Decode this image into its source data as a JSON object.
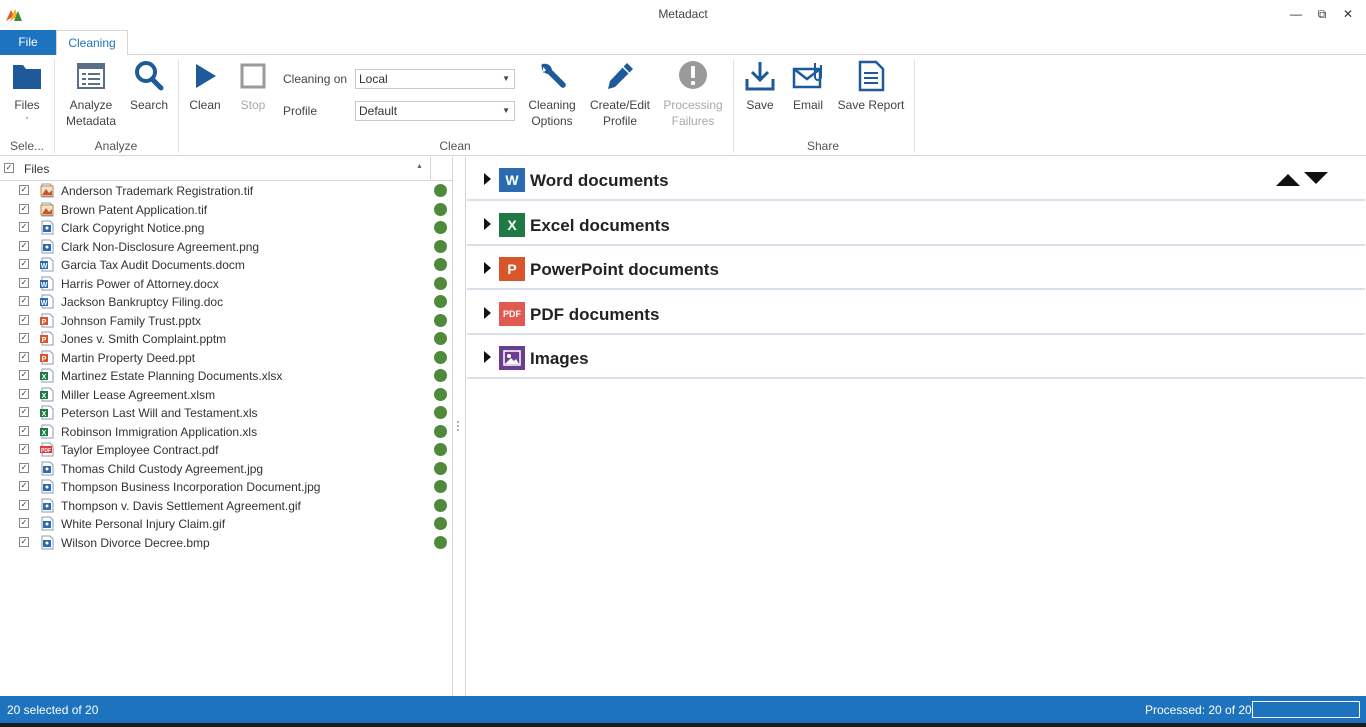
{
  "window": {
    "title": "Metadact",
    "minimize": "—",
    "restore": "⧉",
    "close": "✕"
  },
  "tabs": {
    "file": "File",
    "cleaning": "Cleaning"
  },
  "ribbon": {
    "files_label": "Files",
    "files_sub": "·",
    "analyze_metadata": "Analyze\nMetadata",
    "analyze_metadata_l1": "Analyze",
    "analyze_metadata_l2": "Metadata",
    "search": "Search",
    "clean": "Clean",
    "stop": "Stop",
    "cleaning_on_label": "Cleaning on",
    "cleaning_on_value": "Local",
    "profile_label": "Profile",
    "profile_value": "Default",
    "cleaning_options_l1": "Cleaning",
    "cleaning_options_l2": "Options",
    "create_edit_l1": "Create/Edit",
    "create_edit_l2": "Profile",
    "processing_failures_l1": "Processing",
    "processing_failures_l2": "Failures",
    "save": "Save",
    "email": "Email",
    "save_report": "Save Report",
    "groups": {
      "select": "Sele...",
      "analyze": "Analyze",
      "clean": "Clean",
      "share": "Share"
    }
  },
  "file_list": {
    "header": "Files",
    "files": [
      {
        "name": "Anderson Trademark Registration.tif",
        "type": "tif"
      },
      {
        "name": "Brown Patent Application.tif",
        "type": "tif"
      },
      {
        "name": "Clark Copyright Notice.png",
        "type": "img"
      },
      {
        "name": "Clark Non-Disclosure Agreement.png",
        "type": "img"
      },
      {
        "name": "Garcia Tax Audit Documents.docm",
        "type": "word"
      },
      {
        "name": "Harris Power of Attorney.docx",
        "type": "word"
      },
      {
        "name": "Jackson Bankruptcy Filing.doc",
        "type": "word"
      },
      {
        "name": "Johnson Family Trust.pptx",
        "type": "ppt"
      },
      {
        "name": "Jones v. Smith Complaint.pptm",
        "type": "ppt"
      },
      {
        "name": "Martin Property Deed.ppt",
        "type": "ppt"
      },
      {
        "name": "Martinez Estate Planning Documents.xlsx",
        "type": "excel"
      },
      {
        "name": "Miller Lease Agreement.xlsm",
        "type": "excel"
      },
      {
        "name": "Peterson Last Will and Testament.xls",
        "type": "excel"
      },
      {
        "name": "Robinson Immigration Application.xls",
        "type": "excel"
      },
      {
        "name": "Taylor Employee Contract.pdf",
        "type": "pdf"
      },
      {
        "name": "Thomas Child Custody Agreement.jpg",
        "type": "img"
      },
      {
        "name": "Thompson Business Incorporation Document.jpg",
        "type": "img"
      },
      {
        "name": "Thompson v. Davis Settlement Agreement.gif",
        "type": "img"
      },
      {
        "name": "White Personal Injury Claim.gif",
        "type": "img"
      },
      {
        "name": "Wilson Divorce Decree.bmp",
        "type": "img"
      }
    ]
  },
  "groups": [
    {
      "label": "Word documents",
      "icon": "W",
      "color": "#2b6cb0"
    },
    {
      "label": "Excel documents",
      "icon": "X",
      "color": "#1f7a45"
    },
    {
      "label": "PowerPoint documents",
      "icon": "P",
      "color": "#d9562b"
    },
    {
      "label": "PDF documents",
      "icon": "PDF",
      "color": "#e05a4f"
    },
    {
      "label": "Images",
      "icon": "image-icon",
      "color": "#6b3f8f"
    }
  ],
  "status": {
    "selected": "20 selected of 20",
    "processed": "Processed: 20 of 20",
    "progress": 1.0
  },
  "colors": {
    "accent": "#1e73be",
    "status_ok": "#4e8a3a"
  }
}
